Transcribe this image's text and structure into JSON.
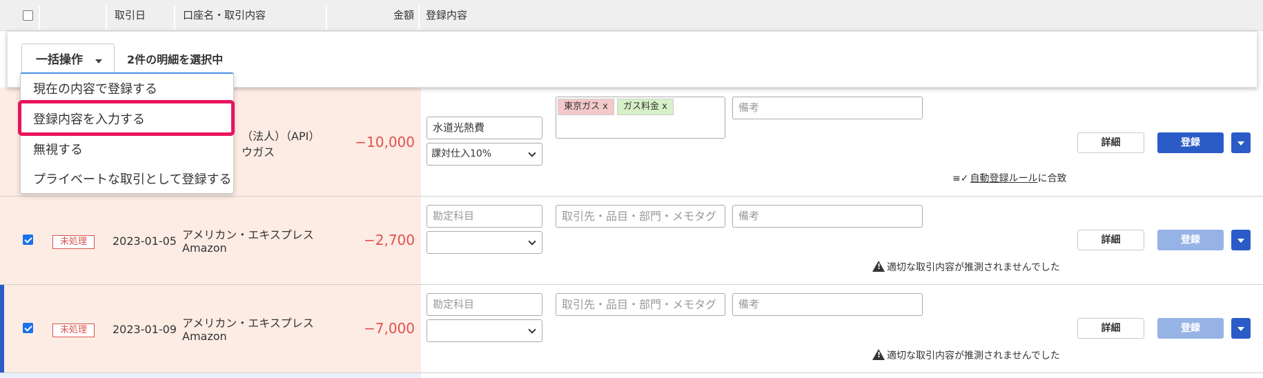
{
  "header": {
    "date": "取引日",
    "account": "口座名・取引内容",
    "amount": "金額",
    "registration": "登録内容"
  },
  "bulk": {
    "button_label": "一括操作",
    "selection_text": "2件の明細を選択中",
    "menu": [
      "現在の内容で登録する",
      "登録内容を入力する",
      "無視する",
      "プライベートな取引として登録する"
    ]
  },
  "rows": [
    {
      "account_line1": "（法人）（API）",
      "account_line2": "ウガス",
      "amount": "−10,000",
      "account_item": "水道光熱費",
      "tax": "課対仕入10%",
      "tags": [
        "東京ガス x",
        "ガス料金 x"
      ],
      "memo_placeholder": "備考",
      "note_link": "自動登録ルール",
      "note_suffix": "に合致",
      "detail": "詳細",
      "register": "登録"
    },
    {
      "checked": true,
      "status": "未処理",
      "date": "2023-01-05",
      "account_line1": "アメリカン・エキスプレス",
      "account_line2": "Amazon",
      "amount": "−2,700",
      "account_placeholder": "勘定科目",
      "tags_placeholder": "取引先・品目・部門・メモタグ",
      "memo_placeholder": "備考",
      "note": "適切な取引内容が推測されませんでした",
      "detail": "詳細",
      "register": "登録"
    },
    {
      "checked": true,
      "status": "未処理",
      "date": "2023-01-09",
      "account_line1": "アメリカン・エキスプレス",
      "account_line2": "Amazon",
      "amount": "−7,000",
      "account_placeholder": "勘定科目",
      "tags_placeholder": "取引先・品目・部門・メモタグ",
      "memo_placeholder": "備考",
      "note": "適切な取引内容が推測されませんでした",
      "detail": "詳細",
      "register": "登録"
    }
  ],
  "colors": {
    "primary": "#2a5bc7",
    "primary_disabled": "#97b3e6",
    "row_bg": "#fdece4",
    "amount": "#e0514c",
    "highlight": "#e8145c",
    "tag1": "#f4c9c9",
    "tag2": "#d7f0c8"
  }
}
